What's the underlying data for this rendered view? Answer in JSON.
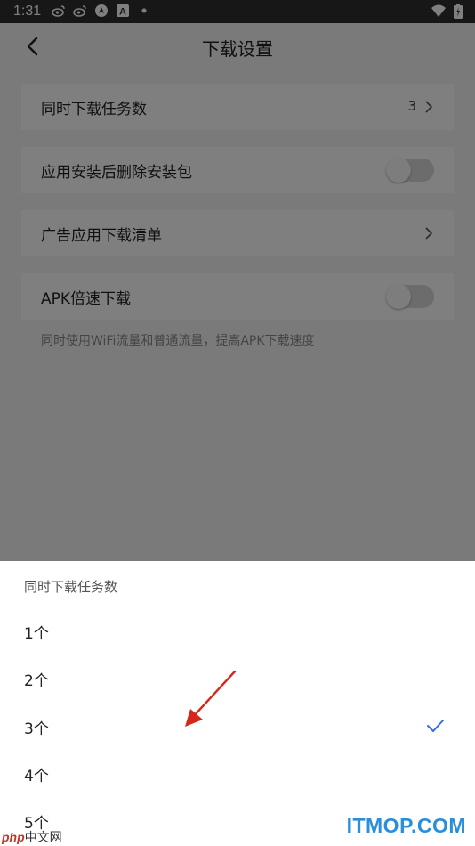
{
  "status_bar": {
    "time": "1:31",
    "left_icons": [
      "weibo-icon",
      "weibo-icon",
      "compass-icon",
      "text-a-icon",
      "dot-icon"
    ],
    "right_icons": [
      "wifi-icon",
      "battery-charging-icon"
    ],
    "a_glyph": "A"
  },
  "header": {
    "title": "下载设置"
  },
  "settings": {
    "concurrent_label": "同时下载任务数",
    "concurrent_value": "3",
    "delete_pkg_label": "应用安装后删除安装包",
    "ad_list_label": "广告应用下载清单",
    "apk_boost_label": "APK倍速下载",
    "apk_boost_hint": "同时使用WiFi流量和普通流量，提高APK下载速度",
    "delete_pkg_on": false,
    "apk_boost_on": false
  },
  "sheet": {
    "title": "同时下载任务数",
    "options": [
      {
        "label": "1个",
        "selected": false
      },
      {
        "label": "2个",
        "selected": false
      },
      {
        "label": "3个",
        "selected": true
      },
      {
        "label": "4个",
        "selected": false
      },
      {
        "label": "5个",
        "selected": false
      }
    ]
  },
  "colors": {
    "accent": "#2f6fe0",
    "arrow": "#d9261c",
    "overlay": "rgba(0,0,0,0.5)"
  },
  "watermarks": {
    "itmop": "ITMOP.COM",
    "php_brand": "php",
    "php_rest": "中文网"
  }
}
